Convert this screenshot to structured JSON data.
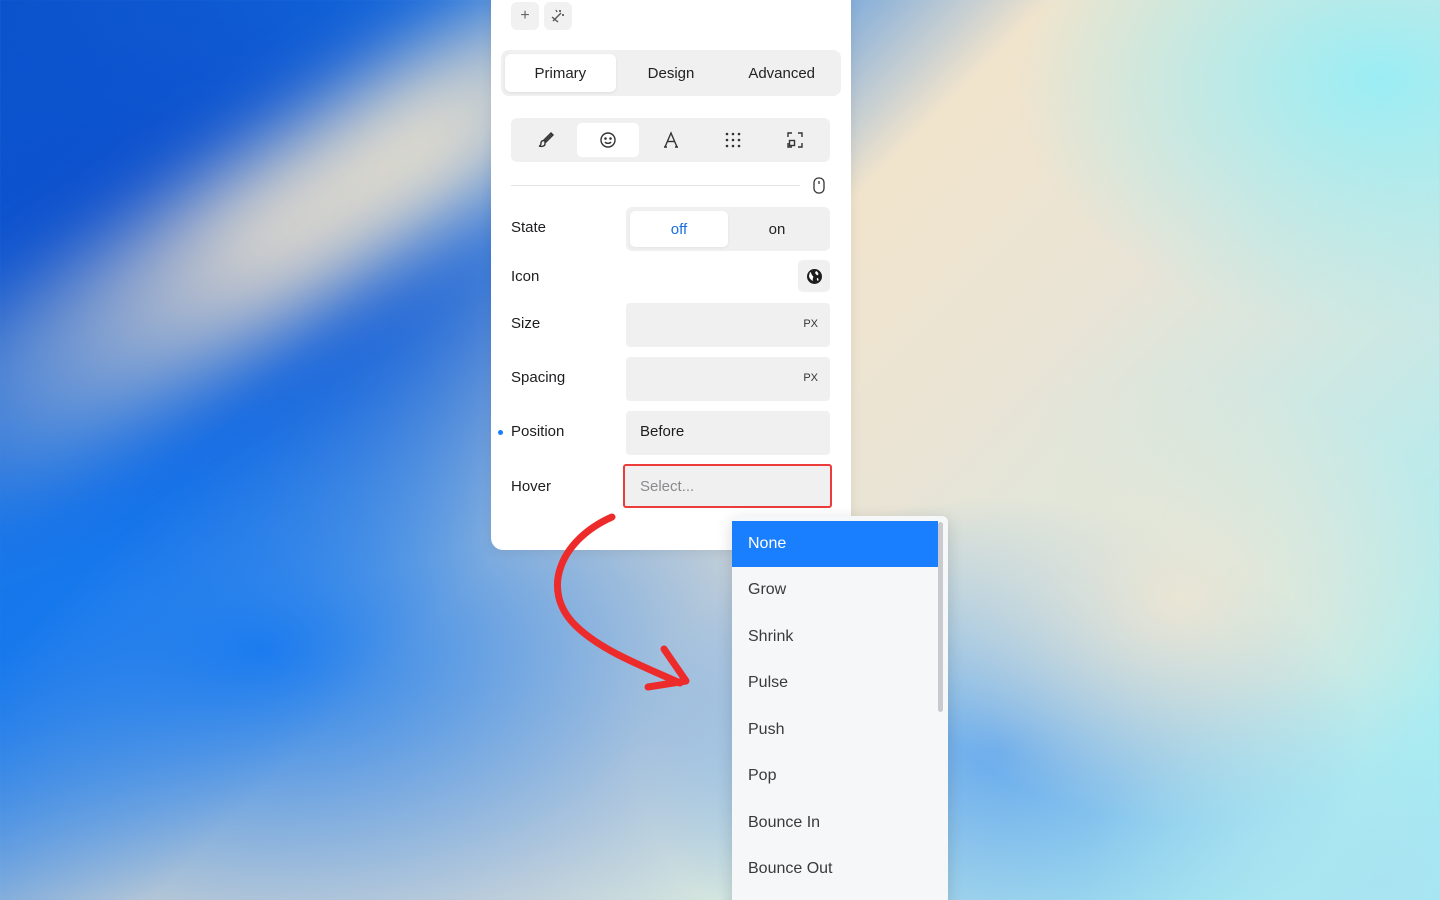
{
  "colors": {
    "accent": "#1a7fff",
    "highlight_border": "#ec3b3b",
    "arrow": "#ee2b2b"
  },
  "toolbar": {
    "add_icon": "plus-icon",
    "magic_icon": "magic-wand-icon"
  },
  "tabs": [
    {
      "label": "Primary",
      "active": true
    },
    {
      "label": "Design",
      "active": false
    },
    {
      "label": "Advanced",
      "active": false
    }
  ],
  "icon_tabs": [
    "brush-icon",
    "smiley-icon",
    "text-style-icon",
    "grid-dots-icon",
    "resize-icon"
  ],
  "fields": {
    "state": {
      "label": "State",
      "options": [
        "off",
        "on"
      ],
      "selected": "off"
    },
    "icon": {
      "label": "Icon",
      "value_icon": "globe-icon"
    },
    "size": {
      "label": "Size",
      "unit": "PX"
    },
    "spacing": {
      "label": "Spacing",
      "unit": "PX"
    },
    "position": {
      "label": "Position",
      "value": "Before"
    },
    "hover": {
      "label": "Hover",
      "placeholder": "Select..."
    }
  },
  "dropdown": {
    "items": [
      "None",
      "Grow",
      "Shrink",
      "Pulse",
      "Push",
      "Pop",
      "Bounce In",
      "Bounce Out"
    ],
    "selected": "None"
  }
}
